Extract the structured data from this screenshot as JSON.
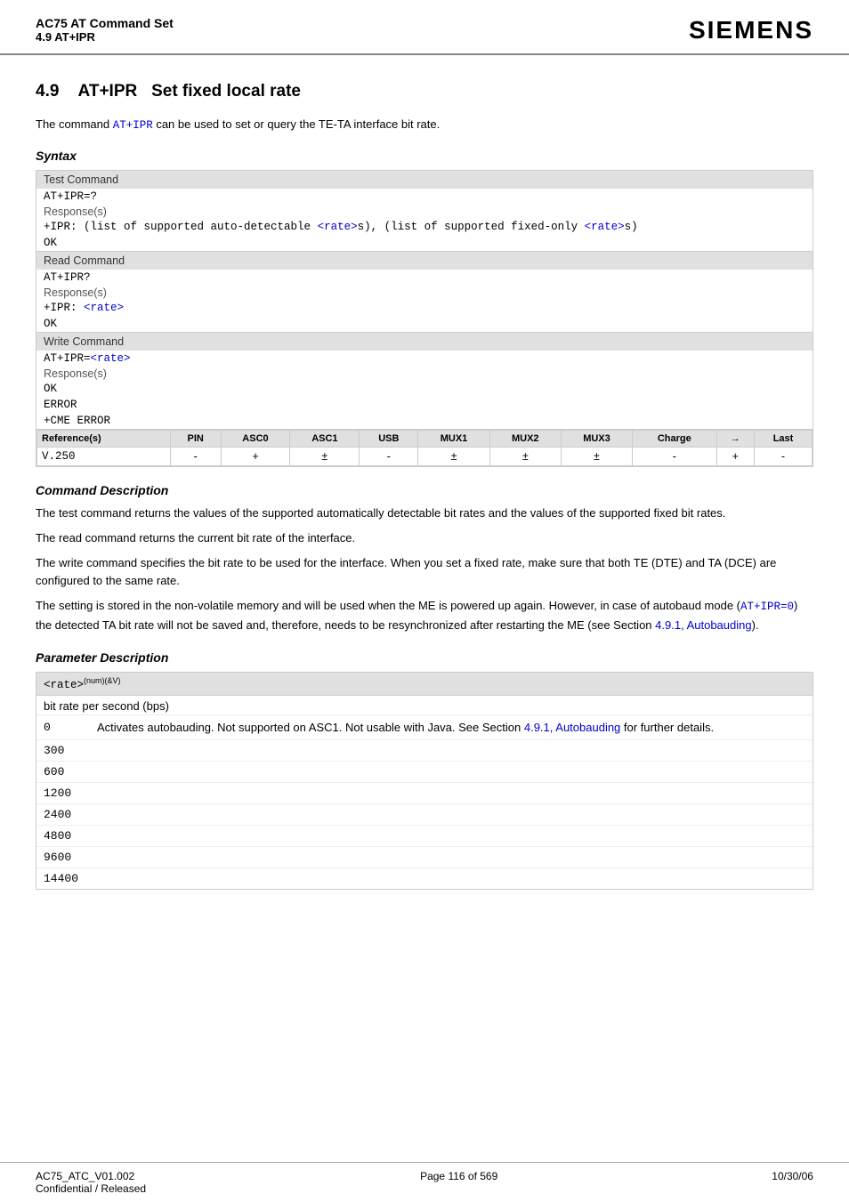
{
  "header": {
    "doc_title": "AC75 AT Command Set",
    "doc_subtitle": "4.9 AT+IPR",
    "brand": "SIEMENS"
  },
  "section": {
    "number": "4.9",
    "title": "AT+IPR",
    "subtitle": "Set fixed local rate",
    "intro_pre": "The command ",
    "intro_cmd": "AT+IPR",
    "intro_post": " can be used to set or query the TE-TA interface bit rate."
  },
  "syntax_label": "Syntax",
  "commands": [
    {
      "section_label": "Test Command",
      "cmd_code": "AT+IPR=?",
      "response_label": "Response(s)",
      "response_lines": [
        "+IPR: (list of supported auto-detectable <rate>s), (list of supported fixed-only <rate>s)",
        "OK"
      ]
    },
    {
      "section_label": "Read Command",
      "cmd_code": "AT+IPR?",
      "response_label": "Response(s)",
      "response_lines": [
        "+IPR: <rate>",
        "OK"
      ]
    },
    {
      "section_label": "Write Command",
      "cmd_code": "AT+IPR=<rate>",
      "response_label": "Response(s)",
      "response_lines": [
        "OK",
        "ERROR",
        "+CME ERROR"
      ]
    }
  ],
  "reference_table": {
    "headers": [
      "Reference(s)",
      "PIN",
      "ASC0",
      "ASC1",
      "USB",
      "MUX1",
      "MUX2",
      "MUX3",
      "Charge",
      "→",
      "Last"
    ],
    "rows": [
      [
        "V.250",
        "-",
        "+",
        "±",
        "-",
        "±",
        "±",
        "±",
        "-",
        "+",
        "-"
      ]
    ]
  },
  "cmd_description": {
    "title": "Command Description",
    "paragraphs": [
      "The test command returns the values of the supported automatically detectable bit rates and the values of the supported fixed bit rates.",
      "The read command returns the current bit rate of the interface.",
      "The write command specifies the bit rate to be used for the interface. When you set a fixed rate, make sure that both TE (DTE) and TA (DCE) are configured to the same rate.",
      "The setting is stored in the non-volatile memory and will be used when the ME is powered up again. However, in case of autobaud mode (AT+IPR=0) the detected TA bit rate will not be saved and, therefore, needs to be resynchronized after restarting the ME (see Section 4.9.1, Autobauding)."
    ],
    "inline_code_refs": [
      "AT+IPR",
      "AT+IPR=0"
    ],
    "link_text": "4.9.1, Autobauding"
  },
  "param_description": {
    "title": "Parameter Description",
    "param_name": "<rate>",
    "param_type": "(num)(&V)",
    "param_label": "bit rate per second (bps)",
    "values": [
      {
        "val": "0",
        "desc_pre": "Activates autobauding. Not supported on ASC1. Not usable with Java. See Section ",
        "desc_link": "4.9.1, Autobauding",
        "desc_post": " for further details."
      },
      {
        "val": "300",
        "desc_pre": "",
        "desc_link": "",
        "desc_post": ""
      },
      {
        "val": "600",
        "desc_pre": "",
        "desc_link": "",
        "desc_post": ""
      },
      {
        "val": "1200",
        "desc_pre": "",
        "desc_link": "",
        "desc_post": ""
      },
      {
        "val": "2400",
        "desc_pre": "",
        "desc_link": "",
        "desc_post": ""
      },
      {
        "val": "4800",
        "desc_pre": "",
        "desc_link": "",
        "desc_post": ""
      },
      {
        "val": "9600",
        "desc_pre": "",
        "desc_link": "",
        "desc_post": ""
      },
      {
        "val": "14400",
        "desc_pre": "",
        "desc_link": "",
        "desc_post": ""
      }
    ]
  },
  "footer": {
    "left_line1": "AC75_ATC_V01.002",
    "left_line2": "Confidential / Released",
    "center": "Page 116 of 569",
    "right": "10/30/06"
  }
}
